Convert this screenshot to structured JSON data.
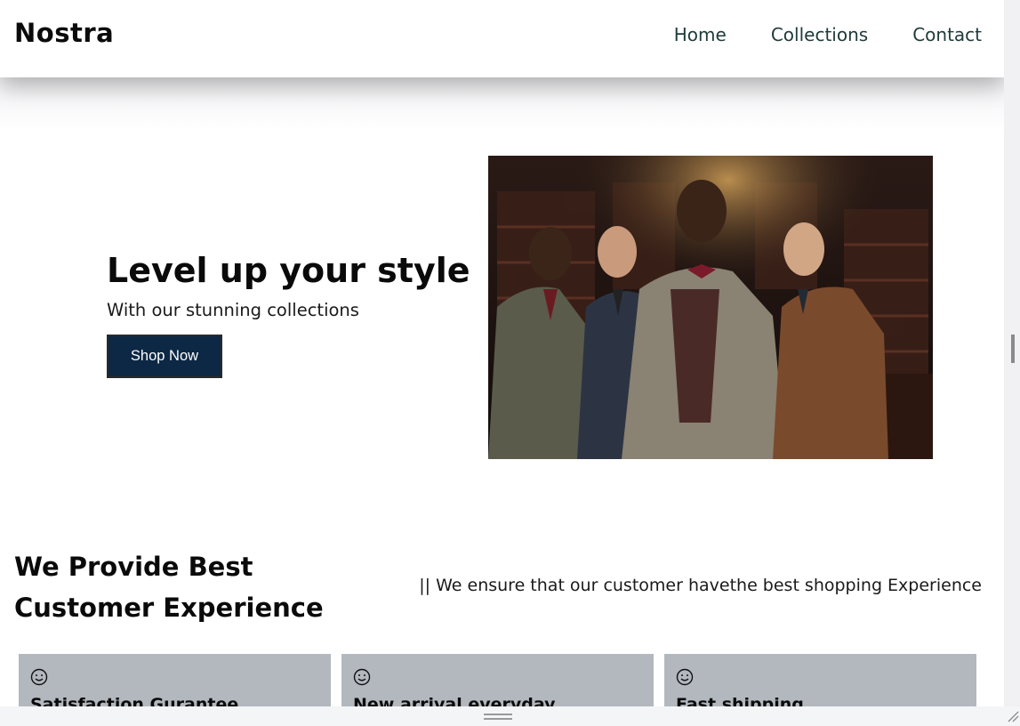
{
  "header": {
    "brand": "Nostra",
    "nav": [
      "Home",
      "Collections",
      "Contact"
    ]
  },
  "hero": {
    "title": "Level up your style",
    "subtitle": "With our stunning collections",
    "button": "Shop Now"
  },
  "experience": {
    "title": "We Provide Best Customer Experience",
    "description": "|| We ensure that our customer havethe best shopping Experience",
    "cards": [
      {
        "icon": "smile-icon",
        "title": "Satisfaction Gurantee"
      },
      {
        "icon": "smile-icon",
        "title": "New arrival everyday"
      },
      {
        "icon": "smile-icon",
        "title": "Fast shipping"
      }
    ]
  },
  "colors": {
    "button_bg": "#0d2844",
    "card_bg": "#b3b8bf",
    "nav_text": "#1f3a3a"
  }
}
